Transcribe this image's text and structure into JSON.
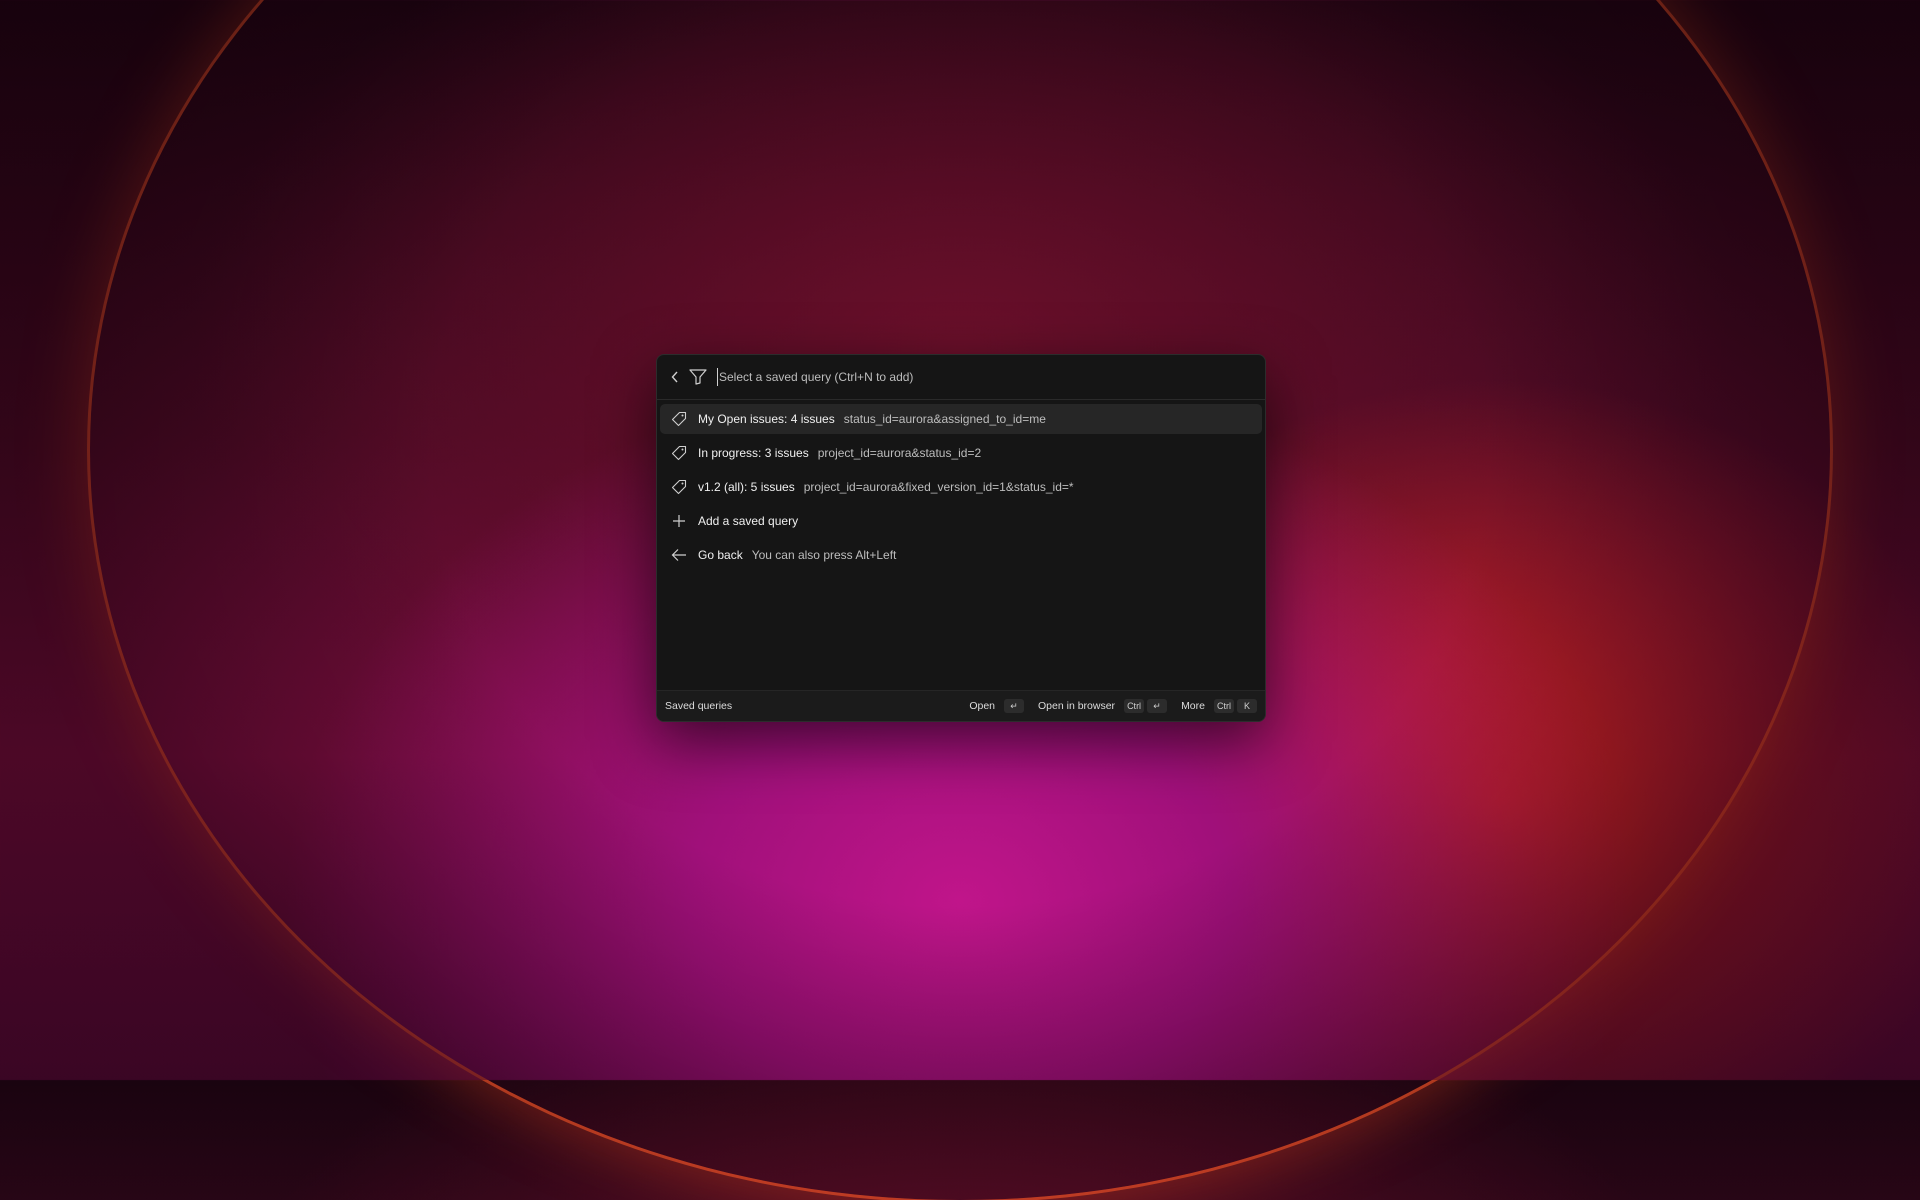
{
  "search": {
    "placeholder": "Select a saved query (Ctrl+N to add)"
  },
  "items": [
    {
      "icon": "tag-icon",
      "title": "My Open issues: 4 issues",
      "subtitle": "status_id=aurora&assigned_to_id=me",
      "selected": true
    },
    {
      "icon": "tag-icon",
      "title": "In progress: 3 issues",
      "subtitle": "project_id=aurora&status_id=2"
    },
    {
      "icon": "tag-icon",
      "title": "v1.2 (all): 5 issues",
      "subtitle": "project_id=aurora&fixed_version_id=1&status_id=*"
    },
    {
      "icon": "plus-icon",
      "title": "Add a saved query",
      "subtitle": ""
    },
    {
      "icon": "arrow-left-icon",
      "title": "Go back",
      "subtitle": "You can also press Alt+Left"
    }
  ],
  "footer": {
    "title": "Saved queries",
    "open_label": "Open",
    "open_key": "↵",
    "browser_label": "Open in browser",
    "browser_key1": "Ctrl",
    "browser_key2": "↵",
    "more_label": "More",
    "more_key1": "Ctrl",
    "more_key2": "K"
  }
}
